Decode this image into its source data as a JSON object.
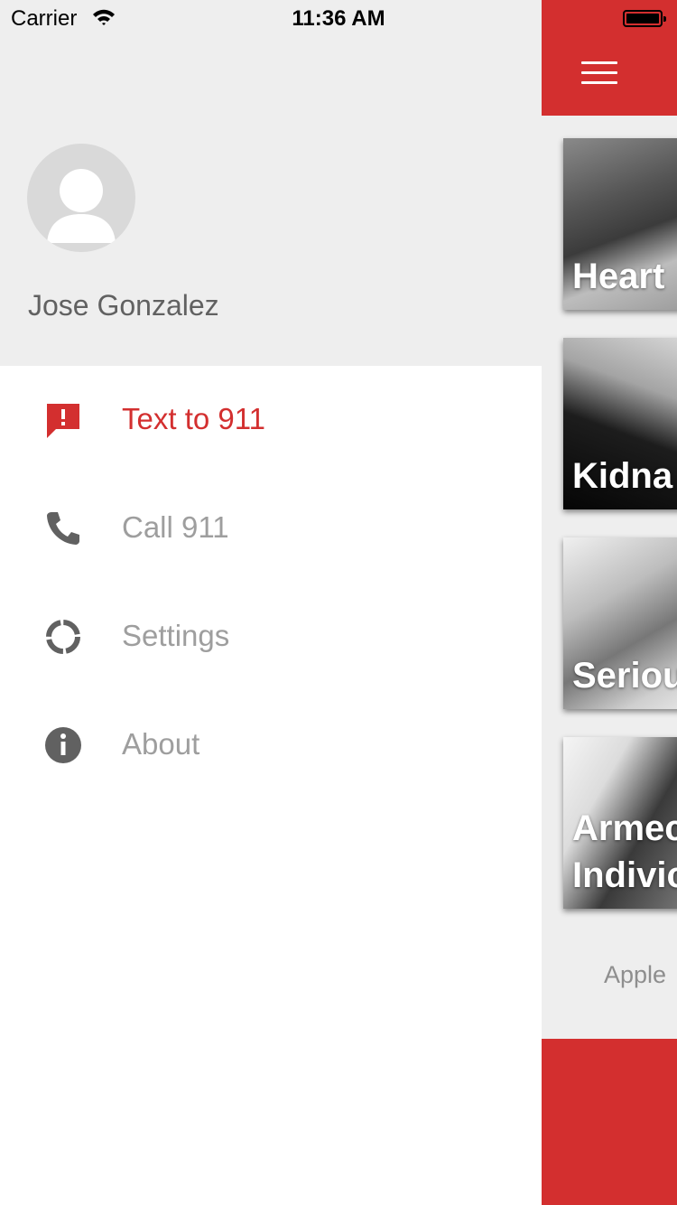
{
  "status_bar": {
    "carrier": "Carrier",
    "time": "11:36 AM"
  },
  "drawer": {
    "user_name": "Jose Gonzalez",
    "items": [
      {
        "label": "Text to 911",
        "icon": "alert-message-icon",
        "active": true
      },
      {
        "label": "Call 911",
        "icon": "phone-icon"
      },
      {
        "label": "Settings",
        "icon": "settings-icon"
      },
      {
        "label": "About",
        "icon": "info-icon"
      }
    ]
  },
  "main": {
    "cards": [
      {
        "title": "Heart"
      },
      {
        "title": "Kidna"
      },
      {
        "title": "Seriou"
      },
      {
        "title_line1": "Armec",
        "title_line2": "Indivic"
      }
    ],
    "footer_text": "Apple"
  },
  "colors": {
    "accent": "#d32f2f",
    "drawer_header_bg": "#eeeeee",
    "inactive_text": "#9e9e9e",
    "icon_gray": "#616161"
  }
}
